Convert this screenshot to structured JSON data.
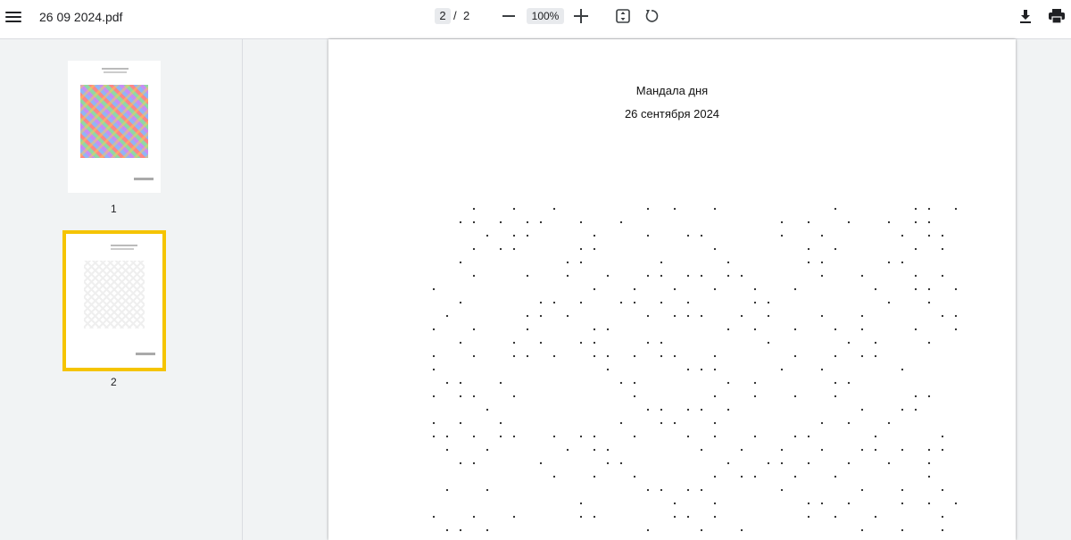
{
  "viewer": {
    "title": "26 09 2024.pdf",
    "current_page": "2",
    "page_separator": "/",
    "total_pages": "2",
    "zoom": "100%"
  },
  "icons": {
    "menu": "menu-icon",
    "zoom_out": "minus-icon",
    "zoom_in": "plus-icon",
    "fit": "fit-page-icon",
    "rotate": "rotate-icon",
    "download": "download-icon",
    "print": "print-icon"
  },
  "sidebar": {
    "thumbnails": [
      {
        "label": "1",
        "selected": false
      },
      {
        "label": "2",
        "selected": true
      }
    ]
  },
  "document": {
    "title": "Мандала дня",
    "date": "26 сентября 2024"
  },
  "colors": {
    "selection": "#f5c400",
    "toolbar_bg": "#ffffff",
    "canvas_bg": "#f1f3f4"
  }
}
